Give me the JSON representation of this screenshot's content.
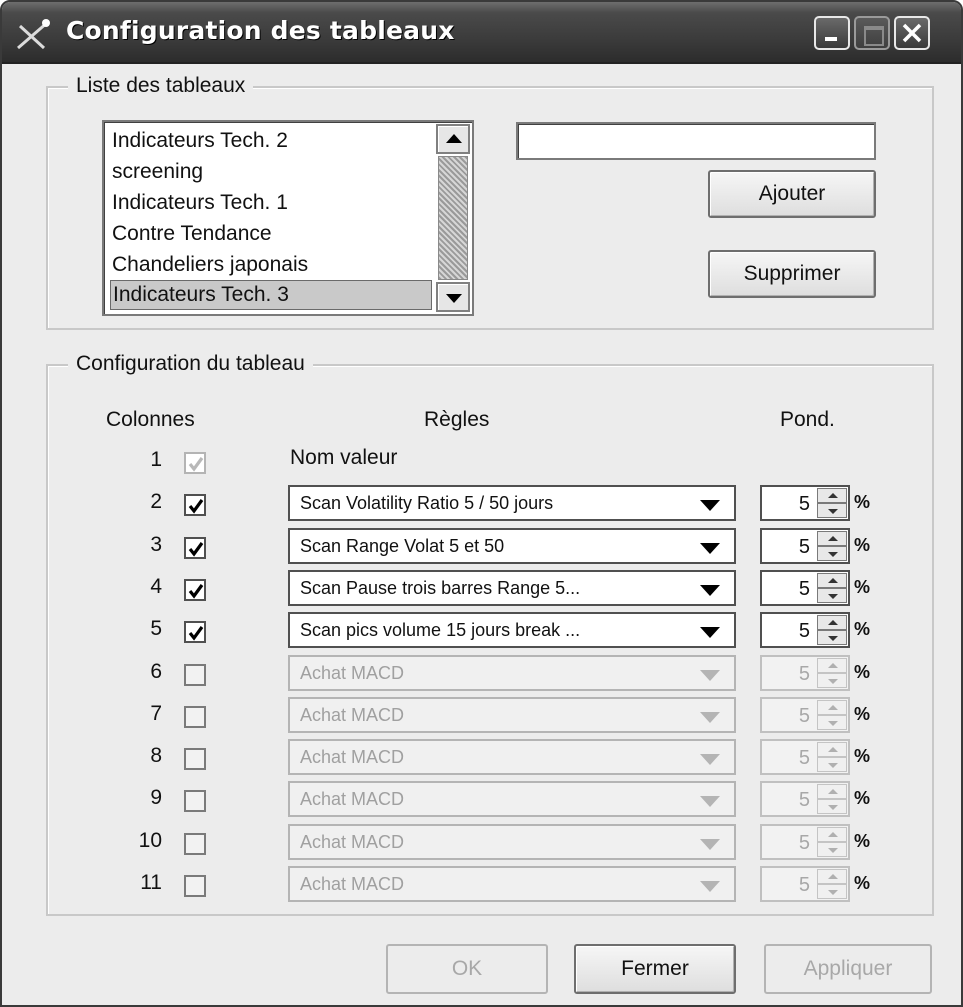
{
  "window": {
    "title": "Configuration des tableaux"
  },
  "list_group": {
    "legend": "Liste des tableaux",
    "items": [
      "Indicateurs Tech. 2",
      "screening",
      "Indicateurs Tech. 1",
      "Contre Tendance",
      "Chandeliers japonais",
      "Indicateurs Tech. 3"
    ],
    "selected_item": "Indicateurs Tech. 3",
    "name_input_value": "",
    "add_label": "Ajouter",
    "delete_label": "Supprimer"
  },
  "config_group": {
    "legend": "Configuration du tableau",
    "headers": {
      "columns": "Colonnes",
      "rules": "Règles",
      "weight": "Pond."
    },
    "rows": [
      {
        "num": "1",
        "checked": true,
        "enabled": false,
        "rule": "Nom valeur"
      },
      {
        "num": "2",
        "checked": true,
        "enabled": true,
        "rule": "Scan Volatility Ratio 5 / 50 jours",
        "weight": "5",
        "unit": "%"
      },
      {
        "num": "3",
        "checked": true,
        "enabled": true,
        "rule": "Scan Range Volat 5 et 50",
        "weight": "5",
        "unit": "%"
      },
      {
        "num": "4",
        "checked": true,
        "enabled": true,
        "rule": "Scan Pause trois barres Range 5...",
        "weight": "5",
        "unit": "%"
      },
      {
        "num": "5",
        "checked": true,
        "enabled": true,
        "rule": "Scan pics volume 15 jours break ...",
        "weight": "5",
        "unit": "%"
      },
      {
        "num": "6",
        "checked": false,
        "enabled": false,
        "rule": "Achat MACD",
        "weight": "5",
        "unit": "%"
      },
      {
        "num": "7",
        "checked": false,
        "enabled": false,
        "rule": "Achat MACD",
        "weight": "5",
        "unit": "%"
      },
      {
        "num": "8",
        "checked": false,
        "enabled": false,
        "rule": "Achat MACD",
        "weight": "5",
        "unit": "%"
      },
      {
        "num": "9",
        "checked": false,
        "enabled": false,
        "rule": "Achat MACD",
        "weight": "5",
        "unit": "%"
      },
      {
        "num": "10",
        "checked": false,
        "enabled": false,
        "rule": "Achat MACD",
        "weight": "5",
        "unit": "%"
      },
      {
        "num": "11",
        "checked": false,
        "enabled": false,
        "rule": "Achat MACD",
        "weight": "5",
        "unit": "%"
      }
    ]
  },
  "footer": {
    "ok_label": "OK",
    "close_label": "Fermer",
    "apply_label": "Appliquer"
  },
  "colors": {
    "title_bar": "#3c3c3c",
    "window_bg": "#ececec",
    "disabled_text": "#a8a8a8"
  }
}
